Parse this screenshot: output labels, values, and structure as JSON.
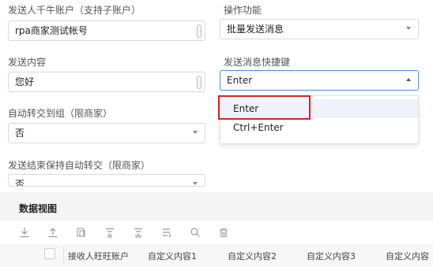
{
  "form": {
    "sender_account": {
      "label": "发送人千牛账户（支持子账户）",
      "value": "rpa商家测试帐号"
    },
    "operation": {
      "label": "操作功能",
      "value": "批量发送消息"
    },
    "content": {
      "label": "发送内容",
      "value": "您好"
    },
    "shortcut": {
      "label": "发送消息快捷键",
      "value": "Enter",
      "options": [
        "Enter",
        "Ctrl+Enter"
      ]
    },
    "auto_transfer": {
      "label": "自动转交到组（限商家）",
      "value": "否"
    },
    "keep_transfer": {
      "label": "发送结束保持自动转交（限商家）",
      "value": "否"
    }
  },
  "grid": {
    "title": "数据视图",
    "toolbar_icons": [
      "download-icon",
      "upload-icon",
      "copy-icon",
      "filter-icon",
      "filter-clear-icon",
      "list-icon",
      "search-icon",
      "delete-icon"
    ],
    "columns": [
      "接收人旺旺账户",
      "自定义内容1",
      "自定义内容2",
      "自定义内容3",
      "自定义内容"
    ]
  },
  "colors": {
    "accent": "#4a90d9",
    "highlight": "#e02020"
  }
}
